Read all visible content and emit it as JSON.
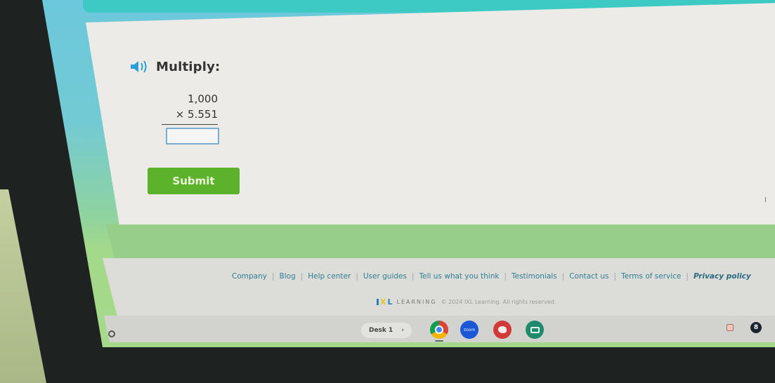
{
  "question": {
    "prompt": "Multiply:",
    "speaker_icon": "speaker-icon",
    "multiplicand": "1,000",
    "multiplier": "× 5.551",
    "answer_value": "",
    "submit_label": "Submit"
  },
  "footer": {
    "links": [
      {
        "label": "Company"
      },
      {
        "label": "Blog"
      },
      {
        "label": "Help center"
      },
      {
        "label": "User guides"
      },
      {
        "label": "Tell us what you think"
      },
      {
        "label": "Testimonials"
      },
      {
        "label": "Contact us"
      },
      {
        "label": "Terms of service"
      },
      {
        "label": "Privacy policy"
      }
    ],
    "separator": "|",
    "logo_text": "IXL",
    "learning_word": "LEARNING",
    "copyright": "© 2024 IXL Learning. All rights reserved."
  },
  "shelf": {
    "desk_label": "Desk 1",
    "desk_chevron": "›",
    "apps": [
      {
        "name": "Chrome",
        "icon": "chrome-icon"
      },
      {
        "name": "Zoom",
        "icon": "zoom-icon",
        "text": "zoom"
      },
      {
        "name": "Art/Paint",
        "icon": "palette-icon"
      },
      {
        "name": "Classroom",
        "icon": "classroom-icon"
      }
    ],
    "tray_badge": "8"
  },
  "colors": {
    "submit_green": "#5cb22a",
    "link_blue": "#2f7f95",
    "answer_box_border": "#7aaed1",
    "header_teal": "#3dcac4"
  }
}
